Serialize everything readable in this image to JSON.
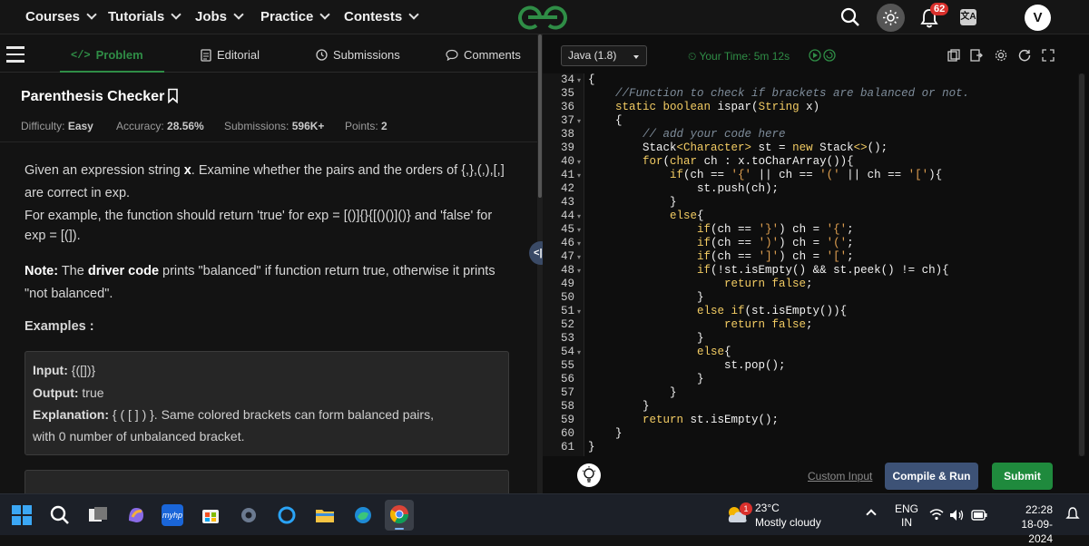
{
  "nav": {
    "items": [
      "Courses",
      "Tutorials",
      "Jobs",
      "Practice",
      "Contests"
    ],
    "notifications": "62",
    "avatar": "V"
  },
  "tabs": {
    "problem": "Problem",
    "editorial": "Editorial",
    "submissions": "Submissions",
    "comments": "Comments"
  },
  "problem": {
    "title": "Parenthesis Checker",
    "difficulty_label": "Difficulty:",
    "difficulty": "Easy",
    "accuracy_label": "Accuracy:",
    "accuracy": "28.56%",
    "submissions_label": "Submissions:",
    "submissions": "596K+",
    "points_label": "Points:",
    "points": "2",
    "desc_1_a": "Given an expression string ",
    "desc_1_b": "x",
    "desc_1_c": ". Examine whether the pairs and the orders of {,},(,),[,]",
    "desc_2": "are correct in exp.",
    "desc_3": "For example, the function should return 'true' for exp = [()]{}{[()()]()} and 'false' for",
    "desc_4": "exp = [(]).",
    "note_label": "Note:",
    "note_a": " The ",
    "note_b": "driver code",
    "note_c": " prints \"balanced\" if function return true, otherwise it prints",
    "note_d": "\"not balanced\".",
    "examples_title": "Examples :",
    "input_label": "Input:",
    "input_value": " {([])}",
    "output_label": "Output:",
    "output_value": " true",
    "expl_label": "Explanation:",
    "expl_value": " { ( [ ] ) }. Same colored brackets can form balanced pairs,",
    "expl_value_2": "with 0 number of unbalanced bracket."
  },
  "editor": {
    "language": "Java (1.8)",
    "timer": "Your Time: 5m 12s",
    "line_numbers": [
      "34",
      "35",
      "36",
      "37",
      "38",
      "39",
      "40",
      "41",
      "42",
      "43",
      "44",
      "45",
      "46",
      "47",
      "48",
      "49",
      "50",
      "51",
      "52",
      "53",
      "54",
      "55",
      "56",
      "57",
      "58",
      "59",
      "60",
      "61"
    ]
  },
  "actions": {
    "custom_input": "Custom Input",
    "compile": "Compile & Run",
    "submit": "Submit"
  },
  "taskbar": {
    "weather_badge": "1",
    "temp": "23°C",
    "weather": "Mostly cloudy",
    "lang_1": "ENG",
    "lang_2": "IN",
    "time": "22:28",
    "date": "18-09-2024"
  },
  "colors": {
    "accent_green": "#2f8d46",
    "compile_blue": "#3d5276",
    "submit_green": "#1f8a3d",
    "badge_red": "#d9302c"
  }
}
